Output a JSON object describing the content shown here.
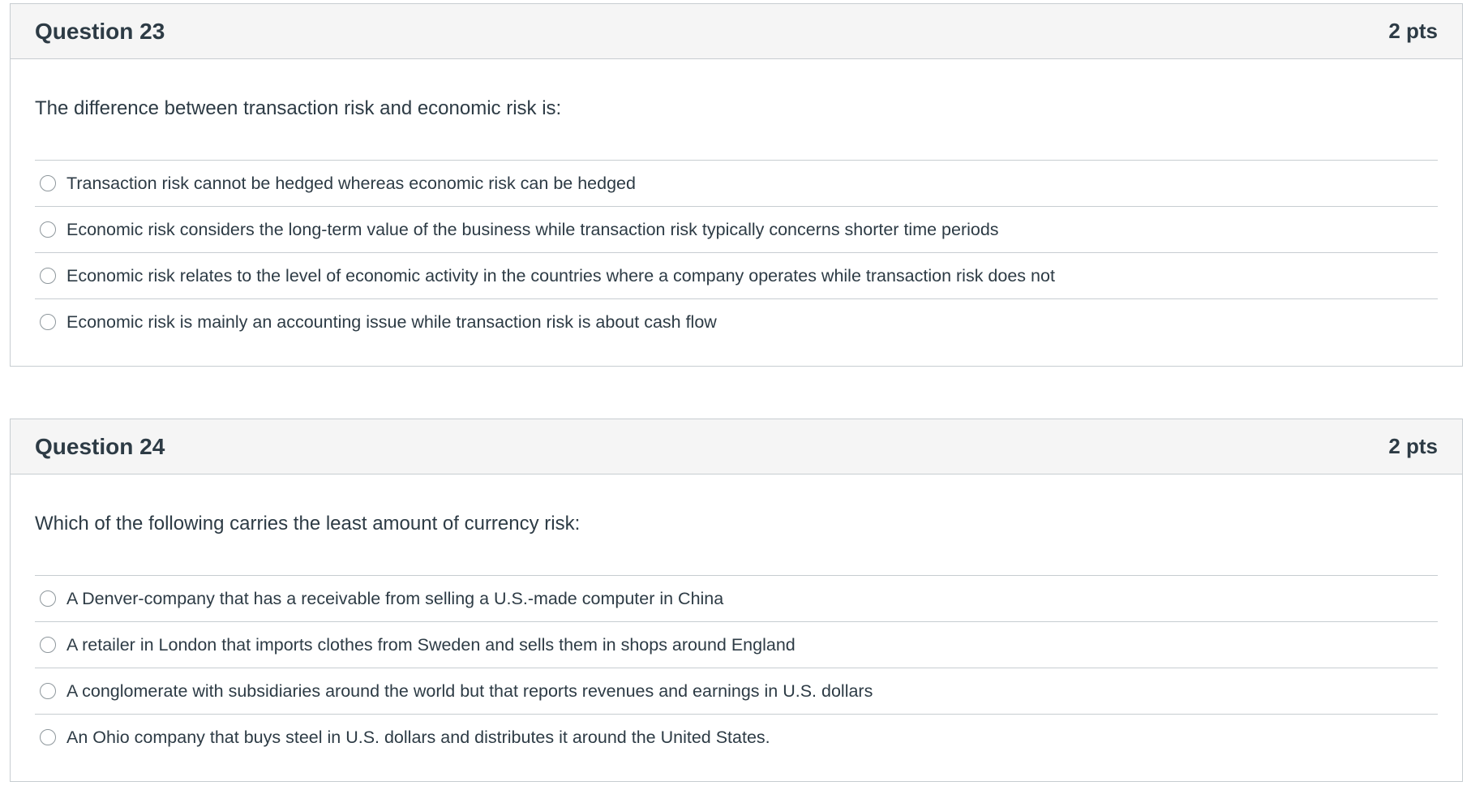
{
  "questions": [
    {
      "title": "Question 23",
      "points": "2 pts",
      "text": "The difference between transaction risk and economic risk is:",
      "answers": [
        "Transaction risk cannot be hedged whereas economic risk can be hedged",
        "Economic risk considers the long-term value of the business while transaction risk typically concerns shorter time periods",
        "Economic risk relates to the level of economic activity in the countries where a company operates while transaction risk does not",
        "Economic risk is mainly an accounting issue while transaction risk is about cash flow"
      ]
    },
    {
      "title": "Question 24",
      "points": "2 pts",
      "text": "Which of the following carries the least amount of currency risk:",
      "answers": [
        "A Denver-company that has a receivable from selling a U.S.-made computer in China",
        "A retailer in London that imports clothes from Sweden and sells them in shops around England",
        "A conglomerate with subsidiaries around the world but that reports revenues and earnings in U.S. dollars",
        "An Ohio company that buys steel in U.S. dollars and distributes it around the United States."
      ]
    }
  ]
}
